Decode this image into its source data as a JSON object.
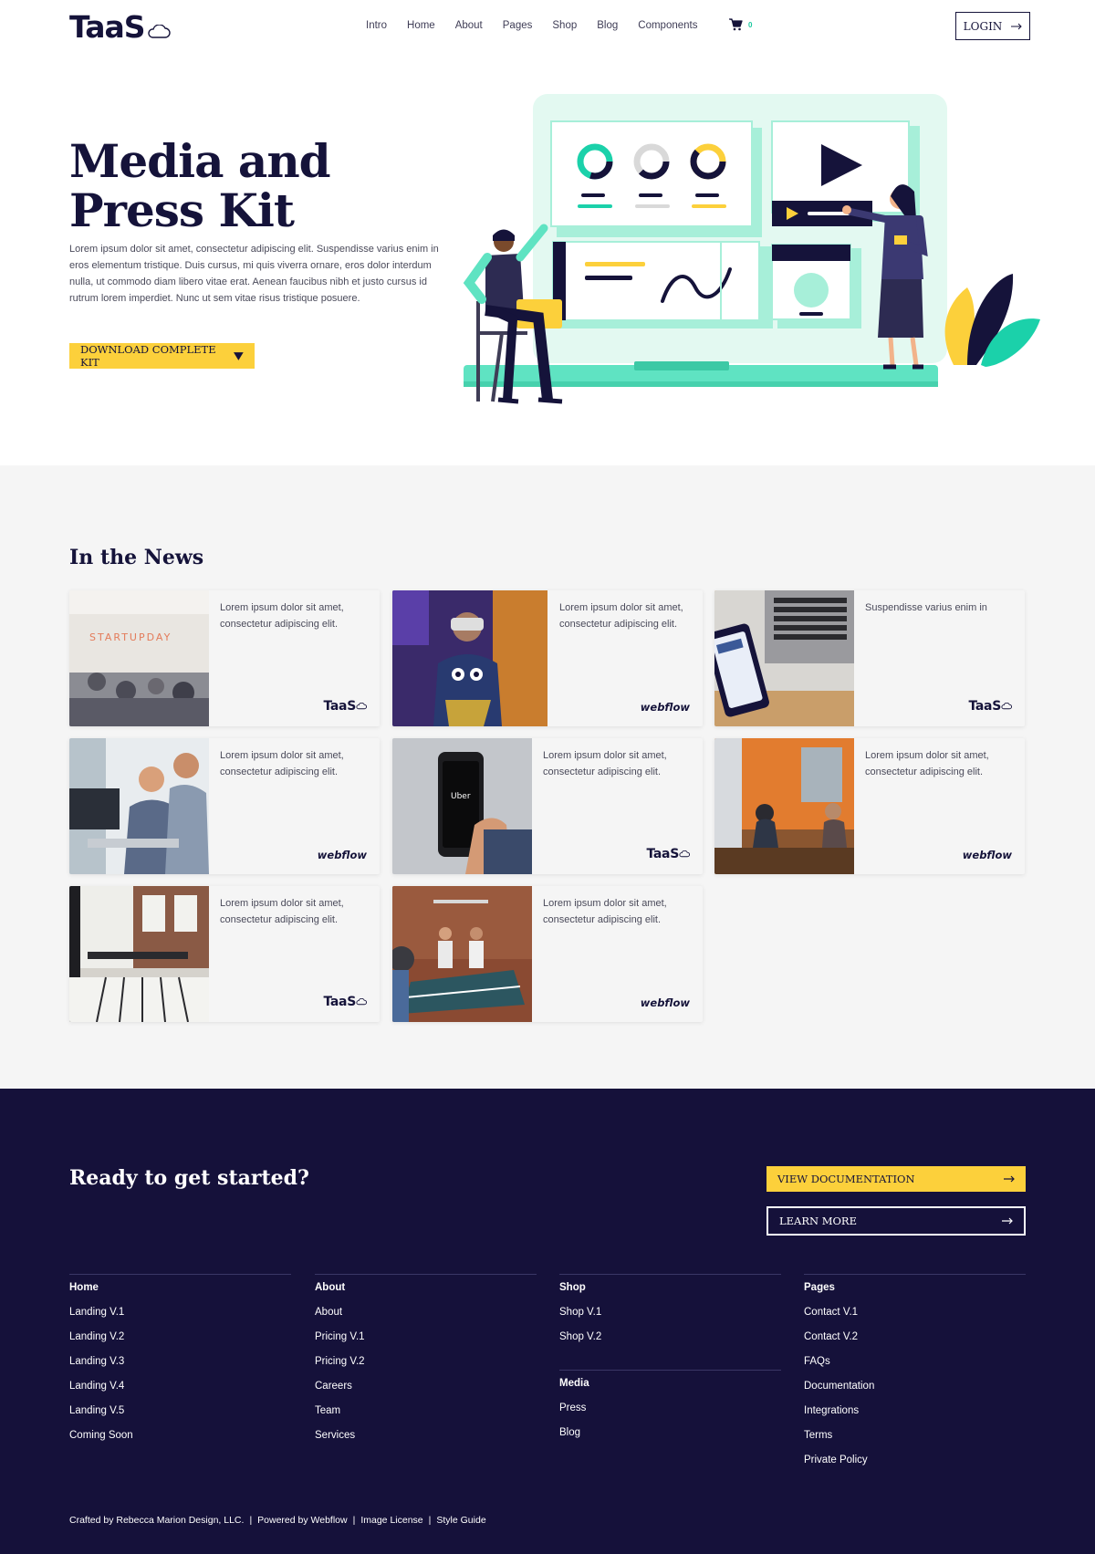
{
  "brand": {
    "name": "TaaS"
  },
  "nav": {
    "links": [
      "Intro",
      "Home",
      "About",
      "Pages",
      "Shop",
      "Blog",
      "Components"
    ],
    "cart_count": "0",
    "login_label": "LOGIN"
  },
  "hero": {
    "title_line1": "Media and",
    "title_line2": "Press Kit",
    "body": "Lorem ipsum dolor sit amet, consectetur adipiscing elit. Suspendisse varius enim in eros elementum tristique. Duis cursus, mi quis viverra ornare, eros dolor interdum nulla, ut commodo diam libero vitae erat. Aenean faucibus nibh et justo cursus id rutrum lorem imperdiet. Nunc ut sem vitae risus tristique posuere.",
    "download_label": "DOWNLOAD COMPLETE KIT"
  },
  "news": {
    "title": "In the News",
    "cards": [
      {
        "text": "Lorem ipsum dolor sit amet, consectetur adipiscing elit.",
        "brand": "TaaS"
      },
      {
        "text": "Lorem ipsum dolor sit amet, consectetur adipiscing elit.",
        "brand": "webflow"
      },
      {
        "text": "Suspendisse varius enim in",
        "brand": "TaaS"
      },
      {
        "text": "Lorem ipsum dolor sit amet, consectetur adipiscing elit.",
        "brand": "webflow"
      },
      {
        "text": "Lorem ipsum dolor sit amet, consectetur adipiscing elit.",
        "brand": "TaaS"
      },
      {
        "text": "Lorem ipsum dolor sit amet, consectetur adipiscing elit.",
        "brand": "webflow"
      },
      {
        "text": "Lorem ipsum dolor sit amet, consectetur adipiscing elit.",
        "brand": "TaaS"
      },
      {
        "text": "Lorem ipsum dolor sit amet, consectetur adipiscing elit.",
        "brand": "webflow"
      }
    ],
    "photo_texts": {
      "startup": "STARTUPDAY",
      "uber": "Uber"
    }
  },
  "cta": {
    "title": "Ready to get started?",
    "doc_label": "VIEW DOCUMENTATION",
    "learn_label": "LEARN MORE"
  },
  "footer": {
    "home": {
      "heading": "Home",
      "links": [
        "Landing V.1",
        "Landing V.2",
        "Landing V.3",
        "Landing V.4",
        "Landing V.5",
        "Coming Soon"
      ]
    },
    "about": {
      "heading": "About",
      "links": [
        "About",
        "Pricing V.1",
        "Pricing V.2",
        "Careers",
        "Team",
        "Services"
      ]
    },
    "shop": {
      "heading": "Shop",
      "links": [
        "Shop V.1",
        "Shop V.2"
      ]
    },
    "media": {
      "heading": "Media",
      "links": [
        "Press",
        "Blog"
      ]
    },
    "pages": {
      "heading": "Pages",
      "links": [
        "Contact V.1",
        "Contact V.2",
        "FAQs",
        "Documentation",
        "Integrations",
        "Terms",
        "Private Policy"
      ]
    },
    "bottom": [
      "Crafted by Rebecca Marion Design, LLC.",
      "Powered by Webflow",
      "Image License",
      "Style Guide"
    ],
    "separator": "|"
  },
  "colors": {
    "navy": "#15113a",
    "yellow": "#fcd03b",
    "mint": "#e6faf2",
    "teal": "#1bd1aa",
    "light_bg": "#f5f5f5"
  },
  "icons": [
    "cloud-icon",
    "cart-icon",
    "arrow-right-icon",
    "caret-down-icon"
  ]
}
